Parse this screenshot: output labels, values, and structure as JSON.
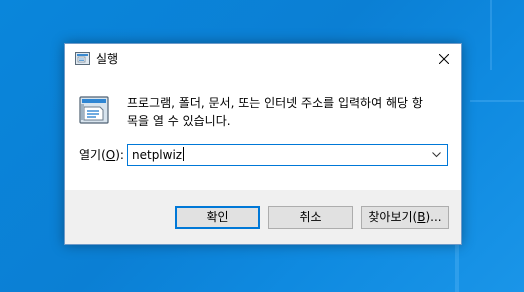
{
  "window": {
    "title": "실행",
    "description": "프로그램, 폴더, 문서, 또는 인터넷 주소를 입력하여 해당 항\n목을 열 수 있습니다.",
    "open_label_pre": "열기(",
    "open_label_key": "O",
    "open_label_post": "):",
    "input_value": "netplwiz",
    "icons": {
      "title": "run-icon",
      "large": "run-icon",
      "close": "close-icon",
      "dropdown": "chevron-down-icon"
    }
  },
  "buttons": {
    "ok_label": "확인",
    "cancel_label": "취소",
    "browse_pre": "찾아보기(",
    "browse_key": "B",
    "browse_post": ")..."
  },
  "colors": {
    "desktop": "#0b7fd4",
    "accent": "#0078d7",
    "dialog_bg": "#f0f0f0",
    "button_bg": "#e1e1e1"
  }
}
